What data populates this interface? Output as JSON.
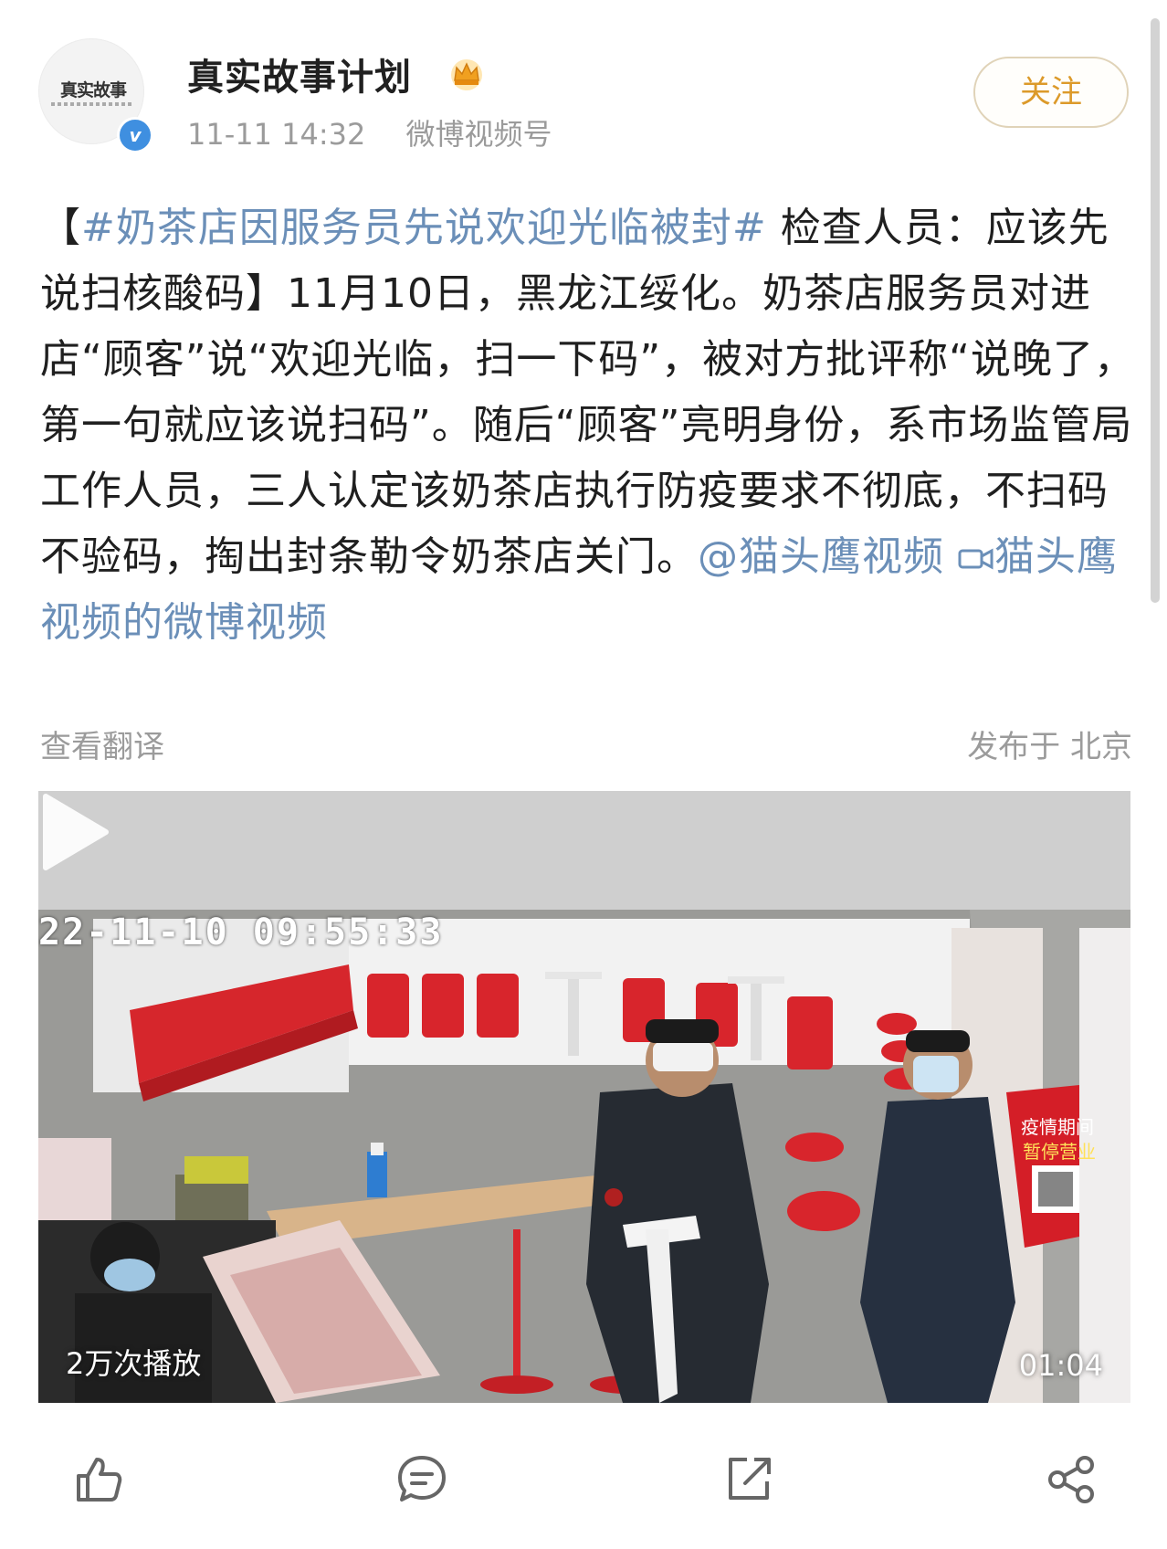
{
  "author": {
    "name": "真实故事计划",
    "avatar_logo": "真实故事",
    "avatar_logo_sub": "计划",
    "time": "11-11 14:32",
    "source": "微博视频号",
    "follow_label": "关注",
    "verified_glyph": "v"
  },
  "post": {
    "hashtag": "#奶茶店因服务员先说欢迎光临被封#",
    "bracket_open": "【",
    "after_hashtag": " 检查人员：应该先说扫核酸码】11月10日，黑龙江绥化。奶茶店服务员对进店“顾客”说“欢迎光临，扫一下码”，被对方批评称“说晚了，第一句就应该说扫码”。随后“顾客”亮明身份，系市场监管局工作人员，三人认定该奶茶店执行防疫要求不彻底，不扫码不验码，掏出封条勒令奶茶店关门。",
    "mention": "@猫头鹰视频",
    "video_link_icon": "video-camera-icon",
    "video_link": "猫头鹰视频的微博视频",
    "translate_label": "查看翻译",
    "location": "发布于 北京"
  },
  "video": {
    "overlay_timestamp": "22-11-10 09:55:33",
    "play_count": "2万次播放",
    "duration": "01:04",
    "sign_text_1": "疫情期间",
    "sign_text_2": "暂停营业"
  },
  "toolbar": {
    "icons": [
      "thumbs-up-icon",
      "comment-icon",
      "share-icon",
      "more-share-icon"
    ]
  },
  "colors": {
    "link": "#6b8fb8",
    "follow": "#dc9a2a",
    "meta": "#9b9b9b"
  }
}
